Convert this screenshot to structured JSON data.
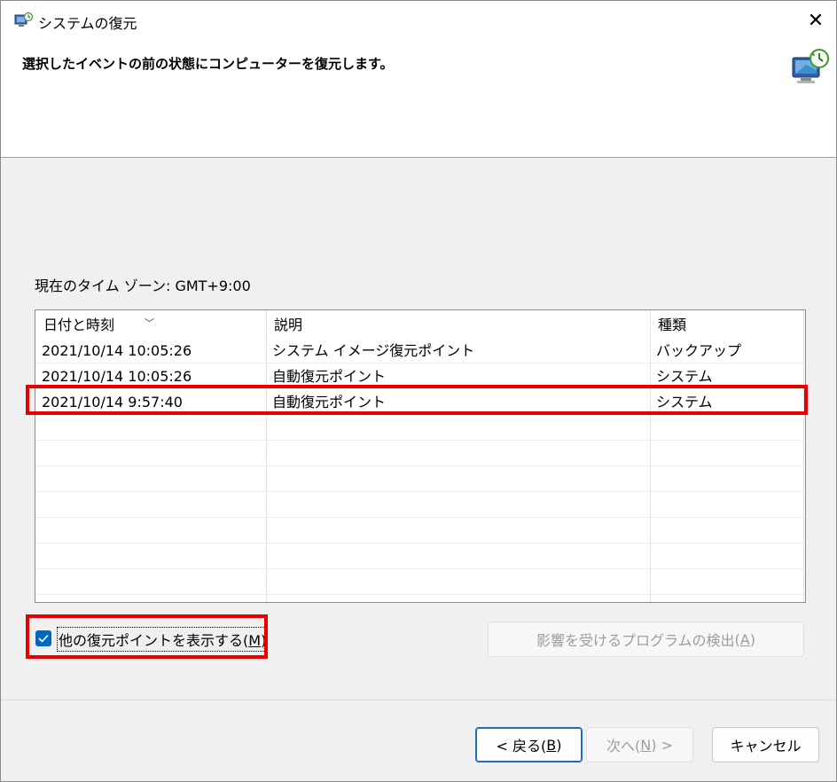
{
  "window": {
    "title": "システムの復元"
  },
  "header": {
    "message": "選択したイベントの前の状態にコンピューターを復元します。"
  },
  "timezone": {
    "label": "現在のタイム ゾーン: GMT+9:00"
  },
  "table": {
    "columns": [
      "日付と時刻",
      "説明",
      "種類"
    ],
    "rows": [
      {
        "date": "2021/10/14 10:05:26",
        "desc": "システム イメージ復元ポイント",
        "type": "バックアップ"
      },
      {
        "date": "2021/10/14 10:05:26",
        "desc": "自動復元ポイント",
        "type": "システム"
      },
      {
        "date": "2021/10/14 9:57:40",
        "desc": "自動復元ポイント",
        "type": "システム"
      }
    ]
  },
  "show_more": {
    "checked": true,
    "label": "他の復元ポイントを表示する",
    "accel": "M"
  },
  "scan_button": {
    "label": "影響を受けるプログラムの検出",
    "accel": "A"
  },
  "buttons": {
    "back": {
      "prefix": "< 戻る(",
      "accel": "B",
      "suffix": ")"
    },
    "next": {
      "prefix": "次へ(",
      "accel": "N",
      "suffix": ") >"
    },
    "cancel": "キャンセル"
  },
  "colors": {
    "accent": "#0067c0",
    "highlight": "#e60000"
  }
}
